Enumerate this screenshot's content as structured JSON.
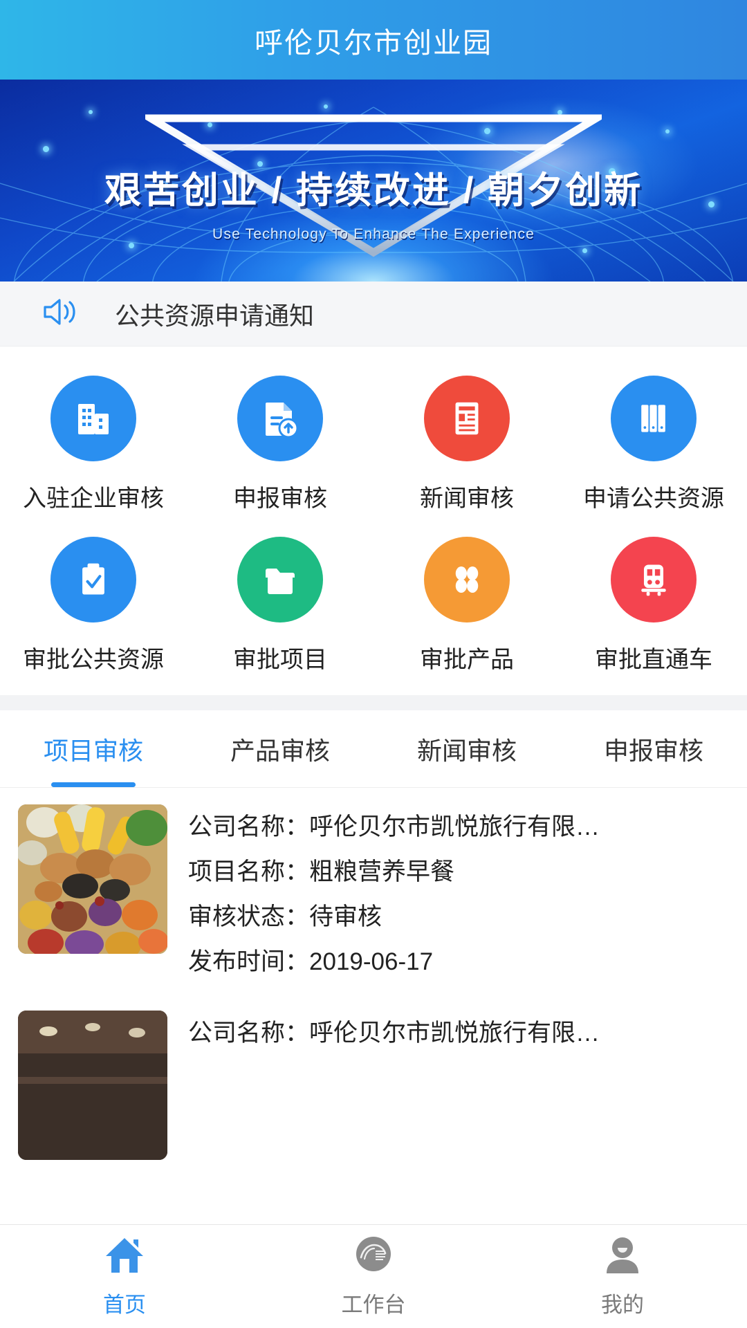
{
  "header": {
    "title": "呼伦贝尔市创业园",
    "accent": "#2a8ff0",
    "gradient_from": "#2fb6e8",
    "gradient_to": "#2f86e0"
  },
  "banner": {
    "headline": "艰苦创业 / 持续改进 / 朝夕创新",
    "subline": "Use Technology To Enhance The Experience",
    "background_color": "#0f47c8"
  },
  "notice": {
    "icon": "speaker-icon",
    "text": "公共资源申请通知"
  },
  "grid": {
    "rows": [
      [
        {
          "label": "入驻企业审核",
          "icon": "buildings-icon",
          "color": "#2a8ff0"
        },
        {
          "label": "申报审核",
          "icon": "document-upload-icon",
          "color": "#2a8ff0"
        },
        {
          "label": "新闻审核",
          "icon": "newspaper-icon",
          "color": "#ef4b3c"
        },
        {
          "label": "申请公共资源",
          "icon": "books-icon",
          "color": "#2a8ff0"
        }
      ],
      [
        {
          "label": "审批公共资源",
          "icon": "clipboard-check-icon",
          "color": "#2a8ff0"
        },
        {
          "label": "审批项目",
          "icon": "folder-icon",
          "color": "#1ebb83"
        },
        {
          "label": "审批产品",
          "icon": "clover-icon",
          "color": "#f59a35"
        },
        {
          "label": "审批直通车",
          "icon": "train-icon",
          "color": "#f4444f"
        }
      ]
    ]
  },
  "tabs": {
    "items": [
      {
        "label": "项目审核",
        "active": true
      },
      {
        "label": "产品审核",
        "active": false
      },
      {
        "label": "新闻审核",
        "active": false
      },
      {
        "label": "申报审核",
        "active": false
      }
    ]
  },
  "list": {
    "items": [
      {
        "thumbnail": "grain-breakfast-photo",
        "company_label": "公司名称：",
        "company_value": "呼伦贝尔市凯悦旅行有限…",
        "project_label": "项目名称：",
        "project_value": "粗粮营养早餐",
        "status_label": "审核状态：",
        "status_value": "待审核",
        "time_label": "发布时间：",
        "time_value": "2019-06-17"
      },
      {
        "thumbnail": "interior-room-photo",
        "company_label": "公司名称：",
        "company_value": "呼伦贝尔市凯悦旅行有限…",
        "project_label": "",
        "project_value": "",
        "status_label": "",
        "status_value": "",
        "time_label": "",
        "time_value": ""
      }
    ]
  },
  "tabbar": {
    "items": [
      {
        "label": "首页",
        "icon": "home-icon",
        "active": true
      },
      {
        "label": "工作台",
        "icon": "workbench-logo-icon",
        "active": false
      },
      {
        "label": "我的",
        "icon": "person-icon",
        "active": false
      }
    ]
  }
}
